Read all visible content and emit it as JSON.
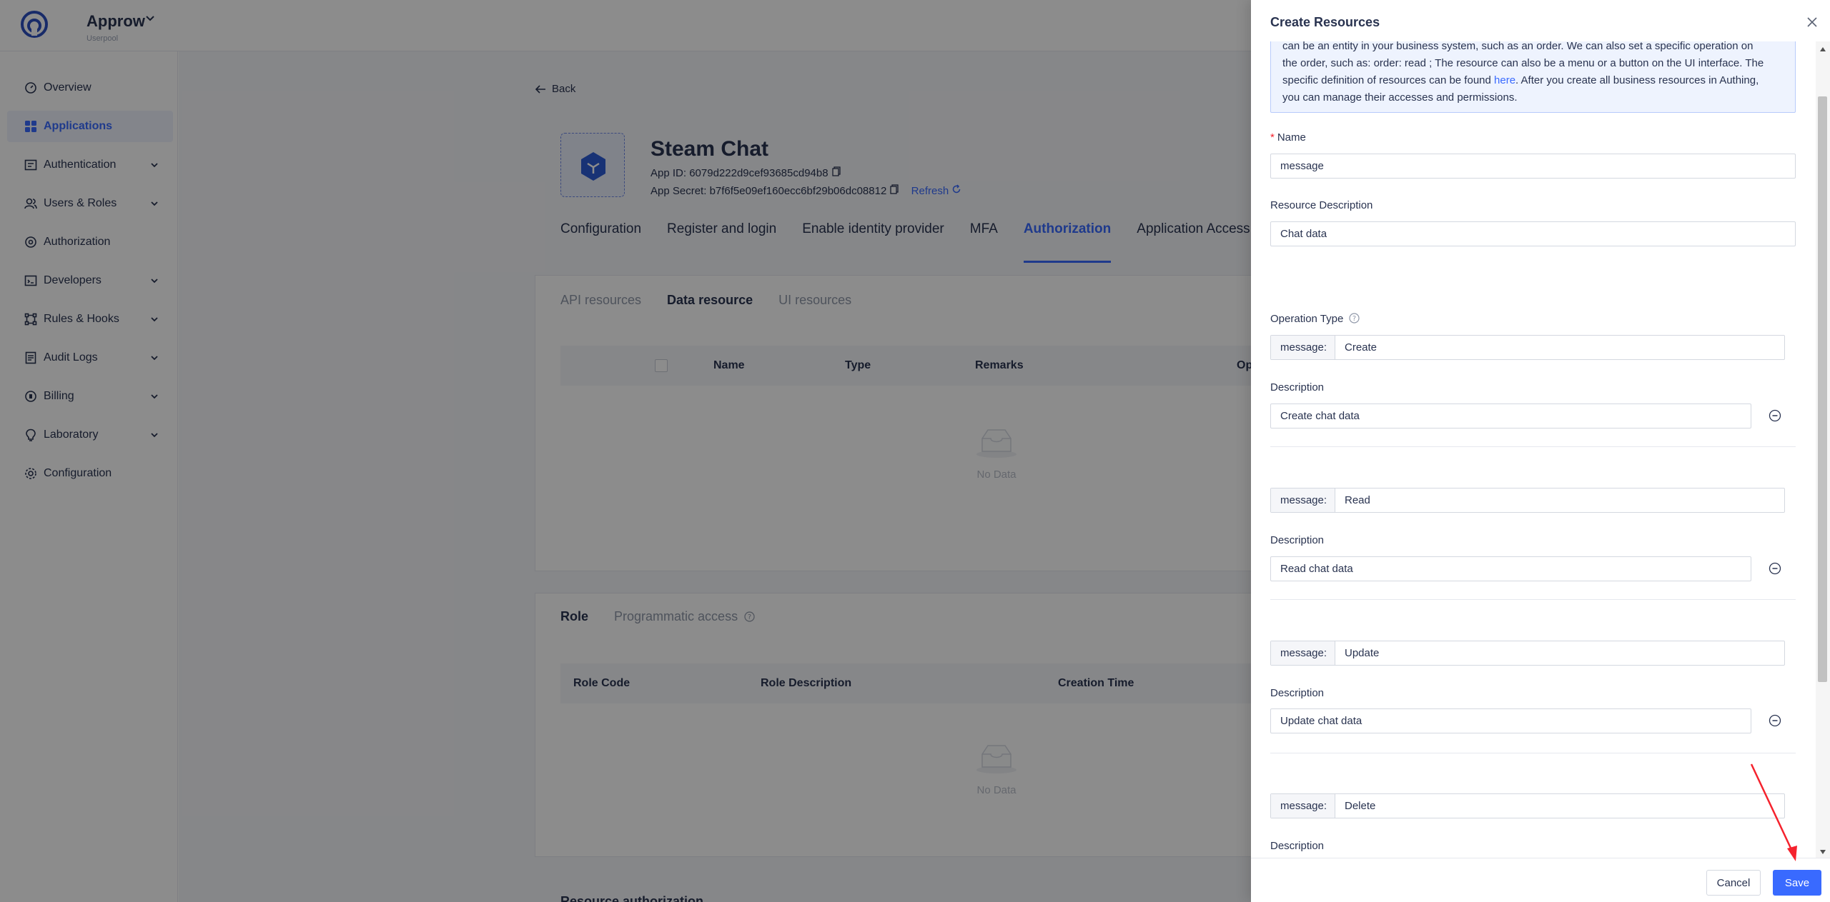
{
  "header": {
    "app_name": "Approw",
    "app_sub": "Userpool"
  },
  "sidebar": {
    "items": [
      {
        "label": "Overview",
        "icon": "dashboard-icon",
        "active": false,
        "expandable": false
      },
      {
        "label": "Applications",
        "icon": "grid-icon",
        "active": true,
        "expandable": false
      },
      {
        "label": "Authentication",
        "icon": "id-card-icon",
        "active": false,
        "expandable": true
      },
      {
        "label": "Users & Roles",
        "icon": "users-icon",
        "active": false,
        "expandable": true
      },
      {
        "label": "Authorization",
        "icon": "key-icon",
        "active": false,
        "expandable": false
      },
      {
        "label": "Developers",
        "icon": "code-icon",
        "active": false,
        "expandable": true
      },
      {
        "label": "Rules & Hooks",
        "icon": "hook-icon",
        "active": false,
        "expandable": true
      },
      {
        "label": "Audit Logs",
        "icon": "log-icon",
        "active": false,
        "expandable": true
      },
      {
        "label": "Billing",
        "icon": "billing-icon",
        "active": false,
        "expandable": true
      },
      {
        "label": "Laboratory",
        "icon": "lab-icon",
        "active": false,
        "expandable": true
      },
      {
        "label": "Configuration",
        "icon": "gear-icon",
        "active": false,
        "expandable": false
      }
    ]
  },
  "main": {
    "back_label": "Back",
    "app_title": "Steam Chat",
    "app_id_label": "App ID:",
    "app_id_value": "6079d222d9cef93685cd94b8",
    "app_secret_label": "App Secret:",
    "app_secret_value": "b7f6f5e09ef160ecc6bf29b06dc08812",
    "refresh_label": "Refresh",
    "tabs": [
      "Configuration",
      "Register and login",
      "Enable identity provider",
      "MFA",
      "Authorization",
      "Application Access Contr"
    ],
    "active_tab": "Authorization",
    "subtabs": [
      "API resources",
      "Data resource",
      "UI resources"
    ],
    "active_subtab": "Data resource",
    "resource_table_headers": [
      "Name",
      "Type",
      "Remarks",
      "Op"
    ],
    "empty_text": "No Data",
    "role_tabs": [
      "Role",
      "Programmatic access"
    ],
    "role_table_headers": [
      "Role Code",
      "Role Description",
      "Creation Time"
    ],
    "resource_auth_title": "Resource authorization"
  },
  "drawer": {
    "title": "Create Resources",
    "info_line1": "can be an entity in your business system, such as an order. We can also set a specific operation on",
    "info_line2": "the order, such as: order: read ; The resource can also be a menu or a button on the UI interface. The",
    "info_line3_pre": "specific definition of resources can be found ",
    "info_link": "here",
    "info_line3_post": ". After you create all business resources in Authing,",
    "info_line4": "you can manage their accesses and permissions.",
    "name_label": "Name",
    "name_value": "message",
    "resource_desc_label": "Resource Description",
    "resource_desc_value": "Chat data",
    "operation_type_label": "Operation Type",
    "description_label": "Description",
    "operations": [
      {
        "prefix": "message:",
        "action": "Create",
        "description": "Create chat data"
      },
      {
        "prefix": "message:",
        "action": "Read",
        "description": "Read chat data"
      },
      {
        "prefix": "message:",
        "action": "Update",
        "description": "Update chat data"
      },
      {
        "prefix": "message:",
        "action": "Delete",
        "description": ""
      }
    ],
    "cancel_label": "Cancel",
    "save_label": "Save"
  },
  "colors": {
    "accent": "#396aff",
    "text": "#293350",
    "overlay": "rgba(0,0,0,0.45)",
    "annotation_arrow": "#f5222d"
  }
}
